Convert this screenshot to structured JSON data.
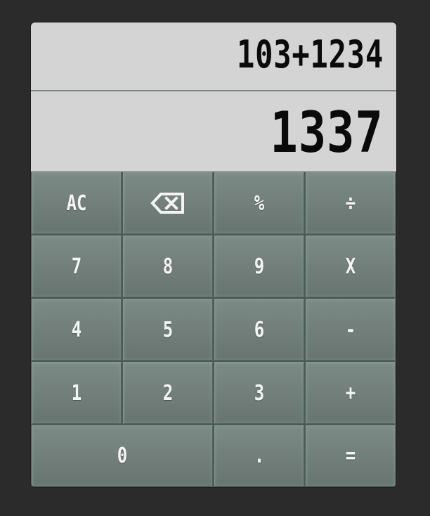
{
  "display": {
    "expression": "103+1234",
    "result": "1337"
  },
  "keys": {
    "all_clear": "AC",
    "backspace_icon": "backspace-icon",
    "percent": "%",
    "divide": "÷",
    "seven": "7",
    "eight": "8",
    "nine": "9",
    "multiply": "X",
    "four": "4",
    "five": "5",
    "six": "6",
    "minus": "-",
    "one": "1",
    "two": "2",
    "three": "3",
    "plus": "+",
    "zero": "0",
    "decimal": ".",
    "equals": "="
  },
  "colors": {
    "background": "#2b2b2b",
    "display": "#d4d4d4",
    "display_text": "#0a0a0a",
    "key": "#72807b",
    "key_text": "#f4f4f4"
  }
}
